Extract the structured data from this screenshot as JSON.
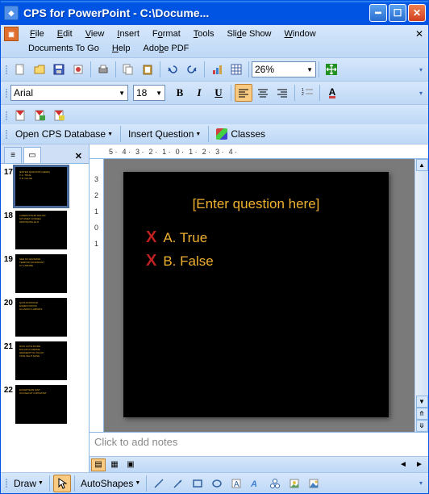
{
  "window": {
    "title": "CPS for PowerPoint - C:\\Docume..."
  },
  "menu": {
    "items": [
      "File",
      "Edit",
      "View",
      "Insert",
      "Format",
      "Tools",
      "Slide Show",
      "Window",
      "Documents To Go",
      "Help",
      "Adobe PDF"
    ]
  },
  "toolbar_std": {
    "zoom": "26%"
  },
  "toolbar_fmt": {
    "font_name": "Arial",
    "font_size": "18"
  },
  "cps": {
    "open_db": "Open CPS Database",
    "insert_q": "Insert Question",
    "classes": "Classes"
  },
  "ruler_h": [
    "5",
    "4",
    "3",
    "2",
    "1",
    "0",
    "1",
    "2",
    "3",
    "4"
  ],
  "ruler_v": [
    "3",
    "2",
    "1",
    "0",
    "1"
  ],
  "thumbs": [
    {
      "n": "17",
      "sel": true,
      "lines": [
        "[ENTER QUESTION HERE]",
        "X A. TRUE",
        "X B. FALSE"
      ]
    },
    {
      "n": "18",
      "sel": false,
      "lines": [
        "LOREM IPSUM DOLOR",
        "SIT AMET CONSEC",
        "ADIPISCING ELIT"
      ]
    },
    {
      "n": "19",
      "sel": false,
      "lines": [
        "SED DO EIUSMOD",
        "TEMPOR INCIDIDUNT",
        "UT LABORE"
      ]
    },
    {
      "n": "20",
      "sel": false,
      "lines": [
        "QUIS NOSTRUD",
        "EXERCITATION",
        "ULLAMCO LABORIS"
      ]
    },
    {
      "n": "21",
      "sel": false,
      "lines": [
        "DUIS AUTE IRURE",
        "DOLOR IN REPRE",
        "HENDERIT IN VOLUP",
        "TATE VELIT ESSE"
      ]
    },
    {
      "n": "22",
      "sel": false,
      "lines": [
        "EXCEPTEUR SINT",
        "OCCAECAT CUPIDATAT"
      ]
    }
  ],
  "slide": {
    "question": "[Enter question here]",
    "answers": [
      {
        "letter": "A.",
        "text": "True"
      },
      {
        "letter": "B.",
        "text": "False"
      }
    ]
  },
  "notes": {
    "placeholder": "Click to add notes"
  },
  "draw": {
    "draw_label": "Draw",
    "autoshapes": "AutoShapes"
  }
}
